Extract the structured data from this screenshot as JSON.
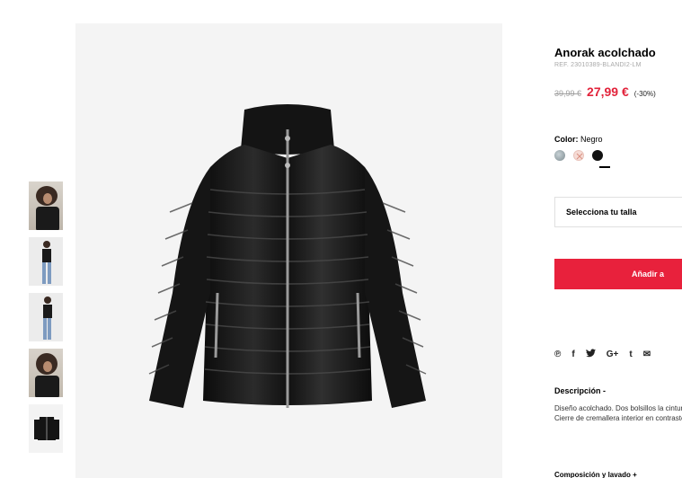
{
  "product": {
    "title": "Anorak acolchado",
    "ref": "REF. 23010389-BLANDI2-LM",
    "old_price": "39,99 €",
    "new_price": "27,99 €",
    "discount": "(-30%)"
  },
  "color": {
    "label": "Color:",
    "selected": "Negro",
    "swatch_colors": [
      "#9aa6ab",
      "#f6dcd6",
      "#111111"
    ]
  },
  "size": {
    "placeholder": "Selecciona tu talla"
  },
  "cart": {
    "add_label": "Añadir a"
  },
  "social": {
    "icons": [
      "pinterest-icon",
      "facebook-icon",
      "twitter-icon",
      "google-plus-icon",
      "tumblr-icon",
      "email-icon"
    ],
    "glyphs": [
      "℗",
      "f",
      "🐦",
      "G+",
      "t",
      "✉"
    ]
  },
  "description": {
    "title": "Descripción -",
    "text": "Diseño acolchado. Dos bolsillos la cintura. Cierre de cremallera interior en contraste."
  },
  "composition": {
    "title": "Composición y lavado +"
  },
  "thumbnails": [
    "model-front-thumb",
    "model-full-thumb",
    "model-side-thumb",
    "model-closeup-thumb",
    "product-thumb"
  ]
}
